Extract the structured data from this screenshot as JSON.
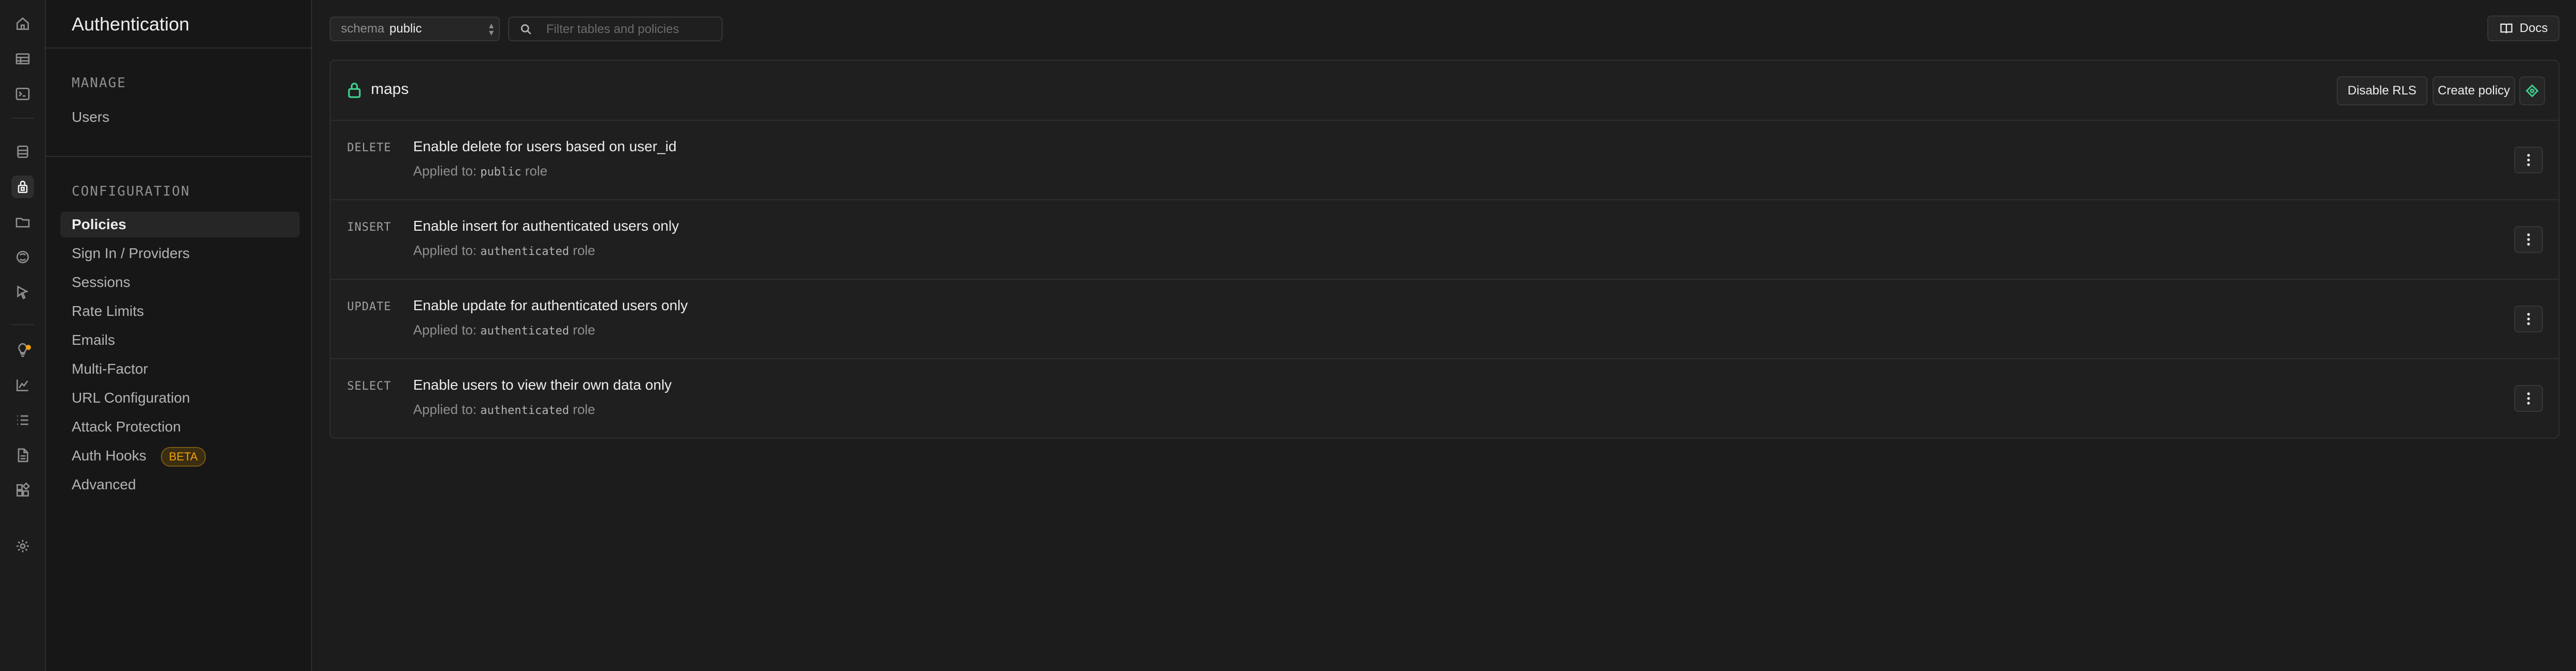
{
  "sidebar": {
    "title": "Authentication",
    "sections": [
      {
        "heading": "MANAGE",
        "items": [
          {
            "label": "Users"
          }
        ]
      },
      {
        "heading": "CONFIGURATION",
        "items": [
          {
            "label": "Policies",
            "active": true
          },
          {
            "label": "Sign In / Providers"
          },
          {
            "label": "Sessions"
          },
          {
            "label": "Rate Limits"
          },
          {
            "label": "Emails"
          },
          {
            "label": "Multi-Factor"
          },
          {
            "label": "URL Configuration"
          },
          {
            "label": "Attack Protection"
          },
          {
            "label": "Auth Hooks",
            "badge": "BETA"
          },
          {
            "label": "Advanced"
          }
        ]
      }
    ]
  },
  "rail_icons": [
    "home-icon",
    "table-editor-icon",
    "sql-editor-icon",
    "database-icon",
    "auth-lock-icon",
    "storage-icon",
    "edge-functions-icon",
    "realtime-icon",
    "advisors-icon",
    "reports-icon",
    "logs-icon",
    "api-docs-icon",
    "integrations-icon",
    "settings-icon"
  ],
  "toolbar": {
    "schema_label": "schema",
    "schema_value": "public",
    "filter_placeholder": "Filter tables and policies",
    "docs_label": "Docs"
  },
  "table": {
    "name": "maps",
    "disable_rls_label": "Disable RLS",
    "create_policy_label": "Create policy",
    "policies": [
      {
        "command": "DELETE",
        "name": "Enable delete for users based on user_id",
        "applied_prefix": "Applied to:",
        "role": "public",
        "role_suffix": "role"
      },
      {
        "command": "INSERT",
        "name": "Enable insert for authenticated users only",
        "applied_prefix": "Applied to:",
        "role": "authenticated",
        "role_suffix": "role"
      },
      {
        "command": "UPDATE",
        "name": "Enable update for authenticated users only",
        "applied_prefix": "Applied to:",
        "role": "authenticated",
        "role_suffix": "role"
      },
      {
        "command": "SELECT",
        "name": "Enable users to view their own data only",
        "applied_prefix": "Applied to:",
        "role": "authenticated",
        "role_suffix": "role"
      }
    ]
  },
  "colors": {
    "accent": "#3ecf8e",
    "badge": "#f1a10d",
    "background": "#1c1c1c"
  }
}
